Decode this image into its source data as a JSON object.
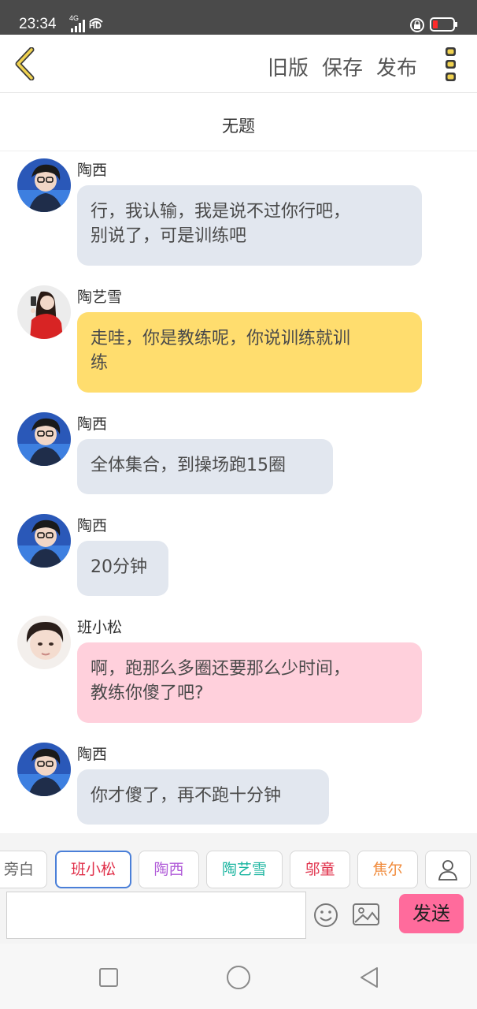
{
  "status_bar": {
    "time": "23:34",
    "network": "4G",
    "hd": "HD"
  },
  "toolbar": {
    "old_version": "旧版",
    "save": "保存",
    "publish": "发布"
  },
  "title": "无题",
  "messages": [
    {
      "speaker": "陶西",
      "text_lines": [
        "行，我认输，我是说不过你行吧，",
        "别说了，可是训练吧"
      ],
      "bubble_color": "#e2e7ef"
    },
    {
      "speaker": "陶艺雪",
      "text_lines": [
        "走哇，你是教练呢，你说训练就训",
        "练"
      ],
      "bubble_color": "#ffdd6e"
    },
    {
      "speaker": "陶西",
      "text_lines": [
        "全体集合，到操场跑15圈"
      ],
      "bubble_color": "#e2e7ef"
    },
    {
      "speaker": "陶西",
      "text_lines": [
        "20分钟"
      ],
      "bubble_color": "#e2e7ef"
    },
    {
      "speaker": "班小松",
      "text_lines": [
        "啊，跑那么多圈还要那么少时间，",
        "教练你傻了吧?"
      ],
      "bubble_color": "#ffd0dc"
    },
    {
      "speaker": "陶西",
      "text_lines": [
        "你才傻了，再不跑十分钟"
      ],
      "bubble_color": "#e2e7ef"
    }
  ],
  "speakers": [
    {
      "label": "旁白",
      "color": "#666666"
    },
    {
      "label": "班小松",
      "color": "#e0304a"
    },
    {
      "label": "陶西",
      "color": "#b05ad8"
    },
    {
      "label": "陶艺雪",
      "color": "#1bb5a0"
    },
    {
      "label": "邬童",
      "color": "#e0304a"
    },
    {
      "label": "焦尔",
      "color": "#f08a3a"
    }
  ],
  "input": {
    "value": "",
    "placeholder": ""
  },
  "send_label": "发送",
  "colors": {
    "accent": "#ff6b9c",
    "selected_chip_border": "#4a7fd8",
    "more_icon": "#e8c64a"
  }
}
